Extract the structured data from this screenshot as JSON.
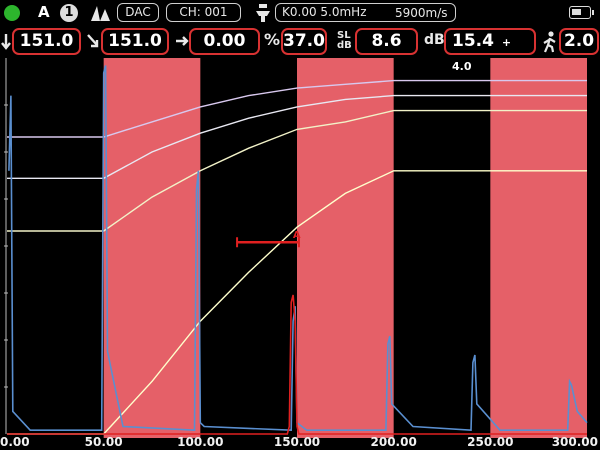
{
  "status": {
    "gate_label": "A",
    "channel_num": "1",
    "mode": "DAC",
    "channel": "CH: 001",
    "k_freq": "K0.00  5.0mHz",
    "velocity": "5900m/s",
    "led_color": "#2db52d",
    "battery_level": 0.55
  },
  "readings": {
    "depth": "151.0",
    "path": "151.0",
    "surface_dist": "0.00",
    "amplitude_symbol": "%",
    "amplitude": "37.0",
    "sl_top": "SL",
    "sl_bottom": "dB",
    "sl_db": "8.6",
    "gain_label": "dB",
    "gain": "15.4",
    "gain_step": "+ 4.0",
    "scan": "2.0"
  },
  "icons": [
    "down-arrow-icon",
    "diagonal-arrow-icon",
    "right-arrow-icon",
    "peak-icon",
    "probe-icon",
    "walker-icon",
    "battery-icon"
  ],
  "chart_data": {
    "type": "line",
    "x_ticks": [
      "0.00",
      "50.00",
      "100.00",
      "150.00",
      "200.00",
      "250.00",
      "300.00"
    ],
    "xlim": [
      0,
      300
    ],
    "ylim": [
      0,
      100
    ],
    "background_bands": [
      [
        50,
        100
      ],
      [
        150,
        200
      ],
      [
        250,
        300
      ]
    ],
    "band_color": "#e56068",
    "gate": {
      "label": "A",
      "start": 119,
      "end": 151,
      "level": 51
    },
    "series": [
      {
        "color": "#5a8fd0",
        "points": [
          [
            1,
            70
          ],
          [
            2,
            90
          ],
          [
            3,
            6
          ],
          [
            12,
            1
          ],
          [
            49,
            1
          ],
          [
            50,
            96
          ],
          [
            51,
            98
          ],
          [
            52,
            22
          ],
          [
            60,
            2
          ],
          [
            97,
            1
          ],
          [
            98,
            65
          ],
          [
            99,
            70
          ],
          [
            100,
            3
          ],
          [
            102,
            2
          ],
          [
            147,
            1
          ],
          [
            148,
            30
          ],
          [
            149,
            34
          ],
          [
            150,
            3
          ],
          [
            155,
            1
          ],
          [
            196,
            1
          ],
          [
            197,
            24
          ],
          [
            198,
            26
          ],
          [
            199,
            8
          ],
          [
            210,
            2
          ],
          [
            240,
            1
          ],
          [
            241,
            19
          ],
          [
            242,
            21
          ],
          [
            243,
            8
          ],
          [
            255,
            1
          ],
          [
            290,
            1
          ],
          [
            291,
            14
          ],
          [
            292,
            13
          ],
          [
            295,
            6
          ],
          [
            300,
            3
          ]
        ]
      },
      {
        "color": "#e02020",
        "points": [
          [
            0,
            0
          ],
          [
            145,
            0
          ],
          [
            146,
            2
          ],
          [
            147,
            35
          ],
          [
            148,
            37
          ],
          [
            149,
            30
          ],
          [
            150,
            2
          ],
          [
            151,
            0
          ],
          [
            300,
            0
          ]
        ]
      }
    ],
    "dac_curves": [
      {
        "color": "#ffffcc",
        "points": [
          [
            0,
            0
          ],
          [
            50,
            0
          ],
          [
            75,
            14
          ],
          [
            100,
            30
          ],
          [
            125,
            43
          ],
          [
            150,
            55
          ],
          [
            175,
            64
          ],
          [
            200,
            70
          ],
          [
            300,
            70
          ]
        ]
      },
      {
        "color": "#f2f2c8",
        "points": [
          [
            0,
            54
          ],
          [
            50,
            54
          ],
          [
            75,
            63
          ],
          [
            100,
            70
          ],
          [
            125,
            76
          ],
          [
            150,
            81
          ],
          [
            175,
            83
          ],
          [
            200,
            86
          ],
          [
            300,
            86
          ]
        ]
      },
      {
        "color": "#e8e8f2",
        "points": [
          [
            0,
            68
          ],
          [
            50,
            68
          ],
          [
            75,
            75
          ],
          [
            100,
            80
          ],
          [
            125,
            84
          ],
          [
            150,
            87
          ],
          [
            175,
            89
          ],
          [
            200,
            90
          ],
          [
            300,
            90
          ]
        ]
      },
      {
        "color": "#d8c8ee",
        "points": [
          [
            0,
            79
          ],
          [
            50,
            79
          ],
          [
            75,
            83
          ],
          [
            100,
            87
          ],
          [
            125,
            90
          ],
          [
            150,
            92
          ],
          [
            175,
            93
          ],
          [
            200,
            94
          ],
          [
            300,
            94
          ]
        ]
      }
    ]
  }
}
